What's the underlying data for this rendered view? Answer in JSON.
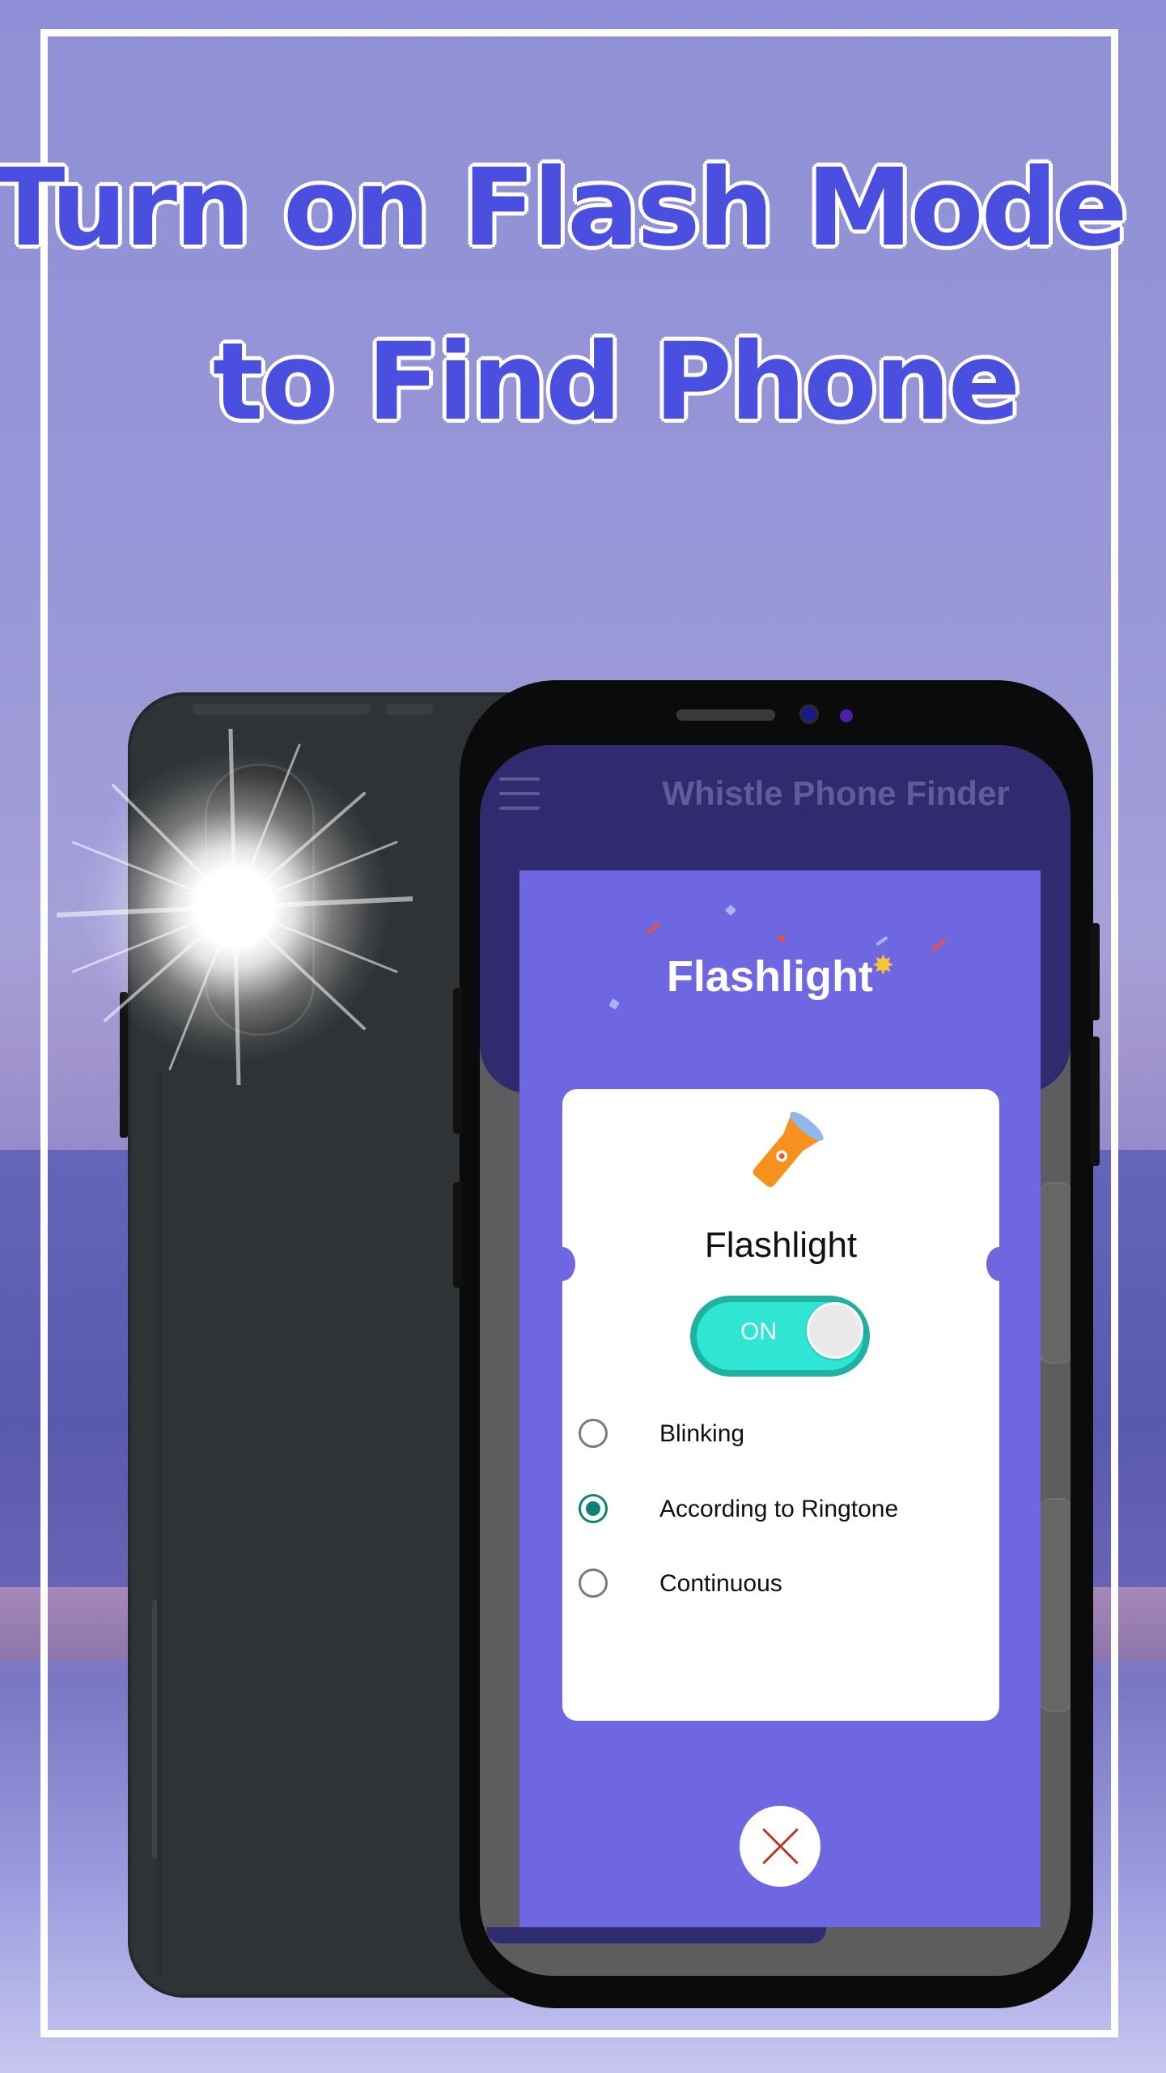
{
  "headline": {
    "line1": "Turn on Flash Mode",
    "line2": "to Find Phone"
  },
  "app": {
    "title": "Whistle Phone Finder"
  },
  "dialog": {
    "title": "Flashlight",
    "card_title": "Flashlight",
    "toggle": {
      "label": "ON",
      "state": "on"
    },
    "options": [
      {
        "label": "Blinking",
        "selected": false
      },
      {
        "label": "According to Ringtone",
        "selected": true
      },
      {
        "label": "Continuous",
        "selected": false
      }
    ]
  },
  "colors": {
    "headline": "#4b4fe0",
    "dialog_bg": "#6f66e1",
    "toggle_on": "#2fe6d5",
    "radio_selected": "#0f8276",
    "torch": "#f7911e",
    "close_x": "#b53a2a"
  },
  "icons": [
    "menu-icon",
    "flashlight-icon",
    "sparkle-icon",
    "close-icon"
  ]
}
